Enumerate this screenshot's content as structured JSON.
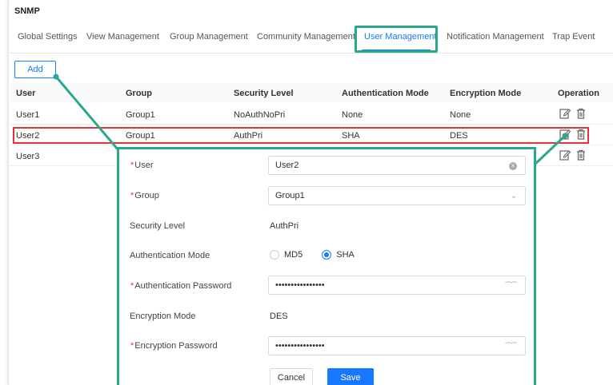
{
  "page": {
    "title": "SNMP"
  },
  "tabs": [
    {
      "label": "Global Settings"
    },
    {
      "label": "View Management"
    },
    {
      "label": "Group Management"
    },
    {
      "label": "Community Management"
    },
    {
      "label": "User Management",
      "active": true
    },
    {
      "label": "Notification Management"
    },
    {
      "label": "Trap Event"
    }
  ],
  "toolbar": {
    "add_label": "Add"
  },
  "table": {
    "columns": [
      "User",
      "Group",
      "Security Level",
      "Authentication Mode",
      "Encryption Mode",
      "Operation"
    ],
    "rows": [
      {
        "user": "User1",
        "group": "Group1",
        "security": "NoAuthNoPri",
        "auth": "None",
        "enc": "None"
      },
      {
        "user": "User2",
        "group": "Group1",
        "security": "AuthPri",
        "auth": "SHA",
        "enc": "DES",
        "highlighted": true
      },
      {
        "user": "User3",
        "group": "",
        "security": "",
        "auth": "",
        "enc": ""
      }
    ]
  },
  "form": {
    "user_label": "User",
    "user_value": "User2",
    "group_label": "Group",
    "group_value": "Group1",
    "security_label": "Security Level",
    "security_value": "AuthPri",
    "auth_mode_label": "Authentication Mode",
    "auth_mode_options": [
      "MD5",
      "SHA"
    ],
    "auth_mode_selected": "SHA",
    "auth_password_label": "Authentication Password",
    "auth_password_value": "••••••••••••••••",
    "enc_mode_label": "Encryption Mode",
    "enc_mode_value": "DES",
    "enc_password_label": "Encryption Password",
    "enc_password_value": "••••••••••••••••",
    "required_mark": "*",
    "cancel_label": "Cancel",
    "save_label": "Save"
  },
  "icons": {
    "edit": "edit-icon",
    "delete": "delete-icon",
    "clear": "clear-icon",
    "dropdown": "chevron-down-icon",
    "password_toggle": "eye-closed-icon"
  },
  "colors": {
    "accent": "#1677ff",
    "annotation_green": "#2ba88a",
    "highlight_red": "#e0323c",
    "required": "#e0323c"
  }
}
